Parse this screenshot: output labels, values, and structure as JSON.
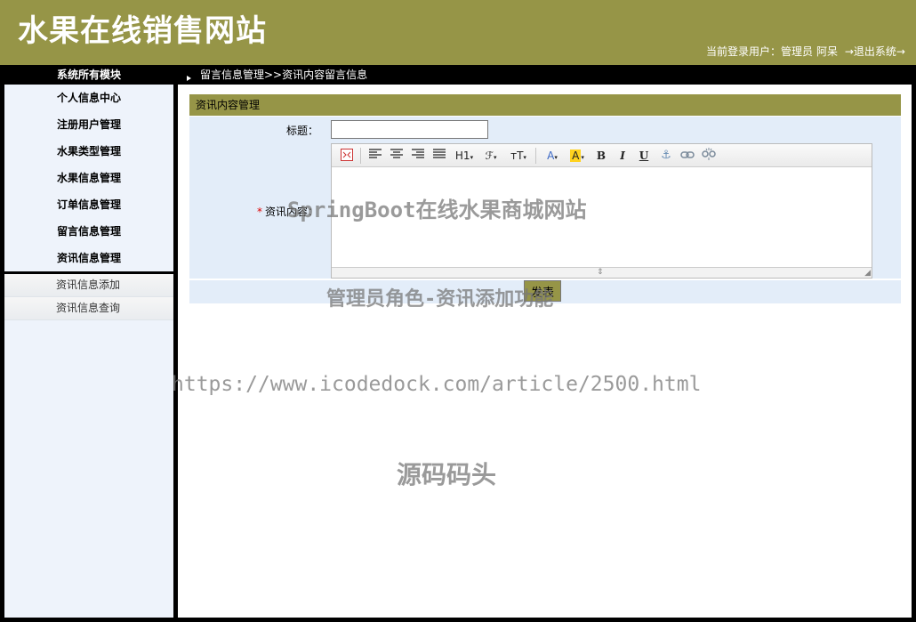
{
  "header": {
    "site_title": "水果在线销售网站",
    "user_label": "当前登录用户：管理员",
    "user_name": "阿呆",
    "logout_label": "→退出系统→"
  },
  "sidebar": {
    "heading": "系统所有模块",
    "items": [
      {
        "label": "个人信息中心"
      },
      {
        "label": "注册用户管理"
      },
      {
        "label": "水果类型管理"
      },
      {
        "label": "水果信息管理"
      },
      {
        "label": "订单信息管理"
      },
      {
        "label": "留言信息管理"
      },
      {
        "label": "资讯信息管理"
      }
    ],
    "sub_items": [
      {
        "label": "资讯信息添加"
      },
      {
        "label": "资讯信息查询"
      }
    ]
  },
  "breadcrumb": "留言信息管理>>资讯内容留言信息",
  "form": {
    "panel_title": "资讯内容管理",
    "title_label": "标题：",
    "title_value": "",
    "content_required_mark": "*",
    "content_label": "资讯内容：",
    "submit_label": "发表"
  },
  "editor_toolbar": {
    "heading": "H1",
    "font": "ℱ",
    "fontsize": "тT",
    "fontcolor": "A",
    "bgcolor": "A",
    "bold": "B",
    "italic": "I",
    "underline": "U"
  },
  "watermarks": {
    "line1": "SpringBoot在线水果商城网站",
    "line2": "管理员角色-资讯添加功能",
    "line3": "https://www.icodedock.com/article/2500.html",
    "line4": "源码码头"
  },
  "colors": {
    "accent": "#969547",
    "form_row_bg": "#e3edf9",
    "sidebar_bg": "#eef3fb"
  }
}
